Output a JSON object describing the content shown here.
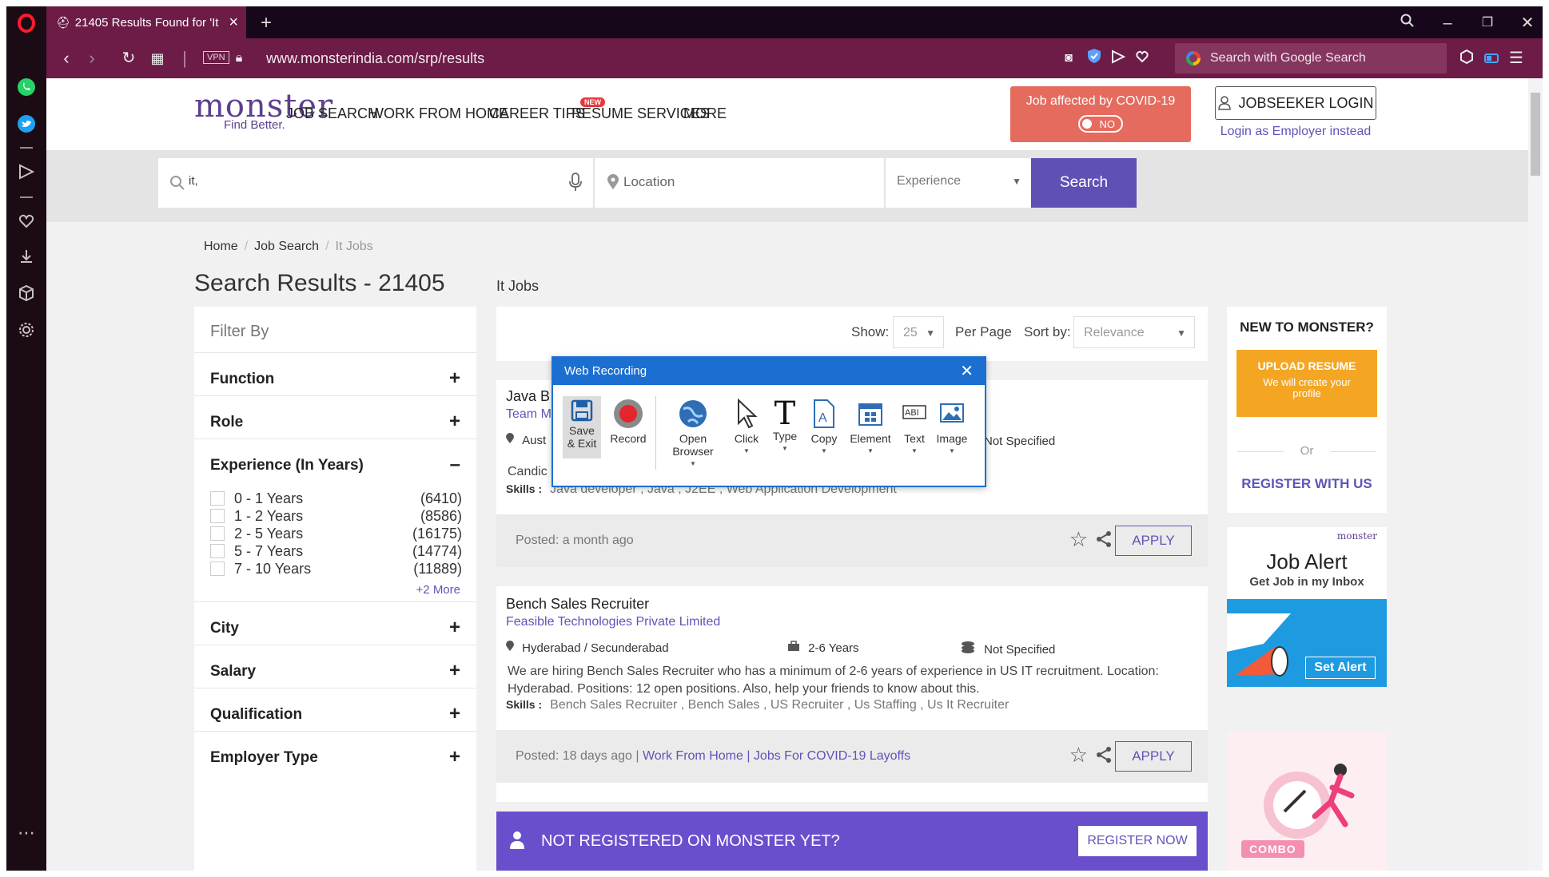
{
  "browser": {
    "tab_title": "21405 Results Found for 'It",
    "url": "www.monsterindia.com/srp/results",
    "vpn_label": "VPN",
    "search_placeholder": "Search with Google Search"
  },
  "header": {
    "logo": "monster",
    "logo_tagline": "Find Better.",
    "nav": [
      "JOB SEARCH",
      "WORK FROM HOME",
      "CAREER TIPS",
      "RESUME SERVICES",
      "MORE"
    ],
    "new_badge": "NEW",
    "covid_text": "Job affected by COVID-19",
    "covid_toggle": "NO",
    "login_label": "JOBSEEKER LOGIN",
    "employer_link": "Login as Employer instead"
  },
  "search": {
    "keyword_value": "it,",
    "location_placeholder": "Location",
    "experience_placeholder": "Experience",
    "button": "Search"
  },
  "breadcrumb": [
    "Home",
    "Job Search",
    "It Jobs"
  ],
  "results_title": "Search Results - 21405",
  "results_subtitle": "It Jobs",
  "filters": {
    "heading": "Filter By",
    "sections": [
      "Function",
      "Role",
      "Experience (In Years)",
      "City",
      "Salary",
      "Qualification",
      "Employer Type"
    ],
    "experience_options": [
      {
        "label": "0 - 1 Years",
        "count": "(6410)"
      },
      {
        "label": "1 - 2 Years",
        "count": "(8586)"
      },
      {
        "label": "2 - 5 Years",
        "count": "(16175)"
      },
      {
        "label": "5 - 7 Years",
        "count": "(14774)"
      },
      {
        "label": "7 - 10 Years",
        "count": "(11889)"
      }
    ],
    "more_link": "+2 More"
  },
  "list_controls": {
    "show_label": "Show:",
    "per_page_value": "25",
    "per_page_label": "Per Page",
    "sort_label": "Sort by:",
    "sort_value": "Relevance"
  },
  "jobs": [
    {
      "title": "Java B",
      "company": "Team M",
      "location": "Aust",
      "salary": "Not Specified",
      "desc": "Candic",
      "skills_label": "Skills :",
      "skills": "Java developer , Java , J2EE , Web Application Development",
      "posted": "Posted: a month ago",
      "apply": "APPLY"
    },
    {
      "title": "Bench Sales Recruiter",
      "company": "Feasible Technologies Private Limited",
      "location": "Hyderabad / Secunderabad",
      "experience": "2-6 Years",
      "salary": "Not Specified",
      "desc": "We are hiring Bench Sales Recruiter who has a minimum of 2-6 years of experience in US IT recruitment. Location: Hyderabad. Positions: 12 open positions. Also, help your friends to know about this.",
      "skills_label": "Skills :",
      "skills": "Bench Sales Recruiter , Bench Sales , US Recruiter , Us Staffing , Us It Recruiter",
      "posted": "Posted: 18 days ago |",
      "tags": "Work From Home | Jobs For COVID-19 Layoffs",
      "apply": "APPLY"
    }
  ],
  "register_banner": {
    "text": "NOT REGISTERED ON MONSTER YET?",
    "button": "REGISTER NOW"
  },
  "right_panel": {
    "heading": "NEW TO MONSTER?",
    "upload": "UPLOAD RESUME",
    "upload_sub": "We will create your profile",
    "or": "Or",
    "register": "REGISTER WITH US",
    "alert_brand": "monster",
    "alert_title": "Job Alert",
    "alert_sub": "Get Job in my Inbox",
    "alert_btn": "Set Alert",
    "combo_label": "COMBO"
  },
  "recorder": {
    "title": "Web Recording",
    "tools": [
      "Save & Exit",
      "Record",
      "Open Browser",
      "Click",
      "Type",
      "Copy",
      "Element",
      "Text",
      "Image"
    ]
  },
  "colors": {
    "browser_bar": "#6c1c47",
    "brand_purple": "#5f50b5",
    "covid": "#e56b5e",
    "upload": "#f4a623",
    "recorder_blue": "#1b6fd1"
  }
}
